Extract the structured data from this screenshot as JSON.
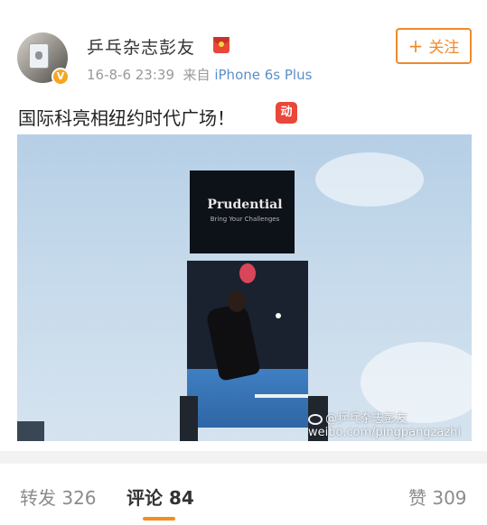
{
  "post": {
    "username": "乒乓杂志彭友",
    "time": "16-8-6 23:39",
    "source_prefix": "来自",
    "device": "iPhone 6s Plus",
    "follow_label": "关注",
    "follow_icon": "plus-icon",
    "text": "国际科亮相纽约时代广场！",
    "emoji_label": "动",
    "verified_icon": "verified-badge-icon",
    "badge_icon": "red-packet-icon"
  },
  "photo": {
    "billboard_brand": "Prudential",
    "billboard_tagline": "Bring Your Challenges",
    "watermark": "@乒乓杂志彭友",
    "watermark_url": "weibo.com/pingpangzazhi"
  },
  "tabs": {
    "repost_label": "转发 326",
    "comment_label": "评论 84",
    "like_label": "赞 309",
    "active": "comment"
  },
  "colors": {
    "accent": "#ef8a2b",
    "link": "#5b8fc9",
    "indicator": "#f78c1d"
  }
}
